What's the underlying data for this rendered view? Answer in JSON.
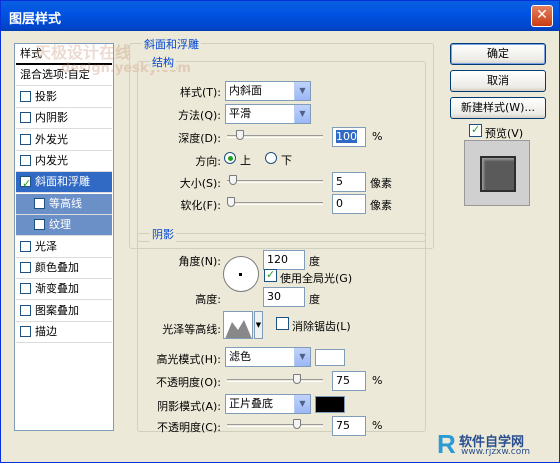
{
  "window": {
    "title": "图层样式",
    "close_glyph": "✕"
  },
  "watermark": {
    "line1": "天极设计在线",
    "line2": "design.yesky.com"
  },
  "sidebar": {
    "items": [
      {
        "label": "样式",
        "checkbox": false
      },
      {
        "label": "混合选项:自定",
        "checkbox": false
      },
      {
        "label": "投影",
        "checkbox": true,
        "checked": false
      },
      {
        "label": "内阴影",
        "checkbox": true,
        "checked": false
      },
      {
        "label": "外发光",
        "checkbox": true,
        "checked": false
      },
      {
        "label": "内发光",
        "checkbox": true,
        "checked": false
      },
      {
        "label": "斜面和浮雕",
        "checkbox": true,
        "checked": true
      },
      {
        "label": "等高线",
        "checkbox": true,
        "checked": false
      },
      {
        "label": "纹理",
        "checkbox": true,
        "checked": false
      },
      {
        "label": "光泽",
        "checkbox": true,
        "checked": false
      },
      {
        "label": "颜色叠加",
        "checkbox": true,
        "checked": false
      },
      {
        "label": "渐变叠加",
        "checkbox": true,
        "checked": false
      },
      {
        "label": "图案叠加",
        "checkbox": true,
        "checked": false
      },
      {
        "label": "描边",
        "checkbox": true,
        "checked": false
      }
    ]
  },
  "bevel": {
    "group_title": "斜面和浮雕",
    "structure_title": "结构",
    "style_label": "样式(T):",
    "style_value": "内斜面",
    "technique_label": "方法(Q):",
    "technique_value": "平滑",
    "depth_label": "深度(D):",
    "depth_value": "100",
    "depth_unit": "%",
    "depth_slider": 0.1,
    "direction_label": "方向:",
    "direction_up": "上",
    "direction_down": "下",
    "size_label": "大小(S):",
    "size_value": "5",
    "size_unit": "像素",
    "size_slider": 0.02,
    "soften_label": "软化(F):",
    "soften_value": "0",
    "soften_unit": "像素",
    "soften_slider": 0.0
  },
  "shading": {
    "group_title": "阴影",
    "angle_label": "角度(N):",
    "angle_value": "120",
    "angle_unit": "度",
    "global_light_label": "使用全局光(G)",
    "altitude_label": "高度:",
    "altitude_value": "30",
    "altitude_unit": "度",
    "gloss_label": "光泽等高线:",
    "antialias_label": "消除锯齿(L)",
    "highlight_mode_label": "高光模式(H):",
    "highlight_mode_value": "滤色",
    "highlight_color": "#ffffff",
    "highlight_opacity_label": "不透明度(O):",
    "highlight_opacity_value": "75",
    "highlight_opacity_unit": "%",
    "highlight_opacity_slider": 0.75,
    "shadow_mode_label": "阴影模式(A):",
    "shadow_mode_value": "正片叠底",
    "shadow_color": "#000000",
    "shadow_opacity_label": "不透明度(C):",
    "shadow_opacity_value": "75",
    "shadow_opacity_unit": "%",
    "shadow_opacity_slider": 0.75
  },
  "buttons": {
    "ok": "确定",
    "cancel": "取消",
    "new_style": "新建样式(W)...",
    "preview_label": "预览(V)"
  },
  "brand": {
    "logo": "R",
    "name": "软件自学网",
    "url": "www.rjzxw.com"
  }
}
